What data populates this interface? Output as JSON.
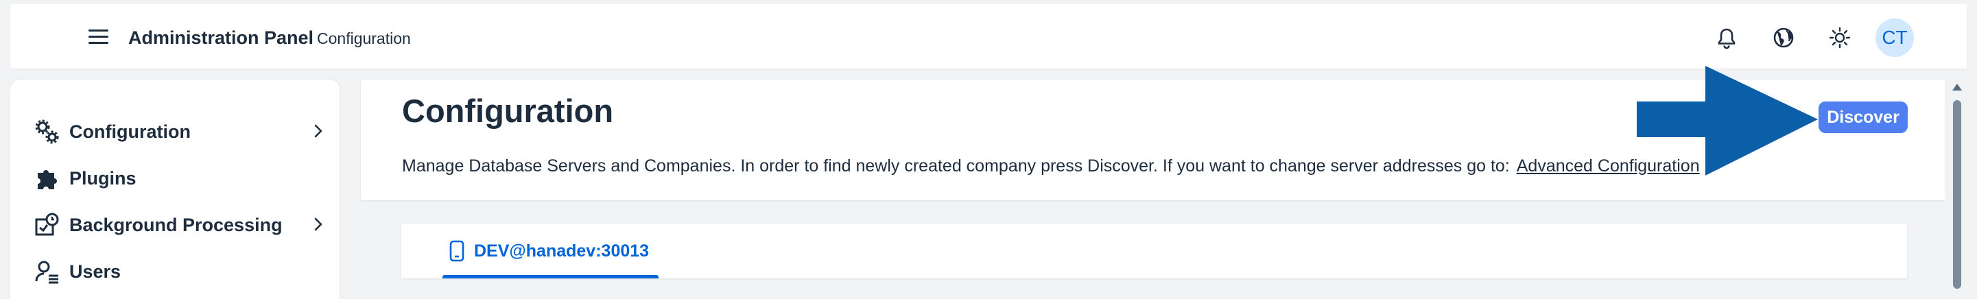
{
  "shell": {
    "app_title": "Administration Panel",
    "app_subtitle": "Configuration",
    "avatar_initials": "CT",
    "actions": [
      "notifications-icon",
      "globe-icon",
      "theme-sun-icon"
    ]
  },
  "sidenav": {
    "items": [
      {
        "label": "Configuration",
        "icon": "gears-icon",
        "has_submenu": true
      },
      {
        "label": "Plugins",
        "icon": "puzzle-icon",
        "has_submenu": false
      },
      {
        "label": "Background Processing",
        "icon": "process-clock-icon",
        "has_submenu": true
      },
      {
        "label": "Users",
        "icon": "users-icon",
        "has_submenu": false
      }
    ]
  },
  "page": {
    "title": "Configuration",
    "description": "Manage Database Servers and Companies. In order to find newly created company press Discover. If you want to change server addresses go to:",
    "link_label": "Advanced Configuration",
    "discover_label": "Discover"
  },
  "tabs": [
    {
      "label": "DEV@hanadev:30013",
      "icon": "device-icon",
      "selected": true
    }
  ],
  "colors": {
    "accent": "#0064d9",
    "discover_button": "#4f7ff0",
    "annotation_arrow": "#0b5ea8",
    "avatar_bg": "#d1e8ff"
  }
}
